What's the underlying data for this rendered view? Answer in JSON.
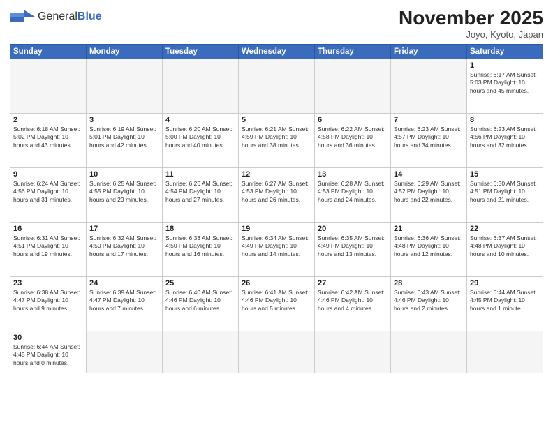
{
  "header": {
    "logo_general": "General",
    "logo_blue": "Blue",
    "month_title": "November 2025",
    "location": "Joyo, Kyoto, Japan"
  },
  "weekdays": [
    "Sunday",
    "Monday",
    "Tuesday",
    "Wednesday",
    "Thursday",
    "Friday",
    "Saturday"
  ],
  "weeks": [
    [
      {
        "day": "",
        "info": "",
        "empty": true
      },
      {
        "day": "",
        "info": "",
        "empty": true
      },
      {
        "day": "",
        "info": "",
        "empty": true
      },
      {
        "day": "",
        "info": "",
        "empty": true
      },
      {
        "day": "",
        "info": "",
        "empty": true
      },
      {
        "day": "",
        "info": "",
        "empty": true
      },
      {
        "day": "1",
        "info": "Sunrise: 6:17 AM\nSunset: 5:03 PM\nDaylight: 10 hours\nand 45 minutes."
      }
    ],
    [
      {
        "day": "2",
        "info": "Sunrise: 6:18 AM\nSunset: 5:02 PM\nDaylight: 10 hours\nand 43 minutes."
      },
      {
        "day": "3",
        "info": "Sunrise: 6:19 AM\nSunset: 5:01 PM\nDaylight: 10 hours\nand 42 minutes."
      },
      {
        "day": "4",
        "info": "Sunrise: 6:20 AM\nSunset: 5:00 PM\nDaylight: 10 hours\nand 40 minutes."
      },
      {
        "day": "5",
        "info": "Sunrise: 6:21 AM\nSunset: 4:59 PM\nDaylight: 10 hours\nand 38 minutes."
      },
      {
        "day": "6",
        "info": "Sunrise: 6:22 AM\nSunset: 4:58 PM\nDaylight: 10 hours\nand 36 minutes."
      },
      {
        "day": "7",
        "info": "Sunrise: 6:23 AM\nSunset: 4:57 PM\nDaylight: 10 hours\nand 34 minutes."
      },
      {
        "day": "8",
        "info": "Sunrise: 6:23 AM\nSunset: 4:56 PM\nDaylight: 10 hours\nand 32 minutes."
      }
    ],
    [
      {
        "day": "9",
        "info": "Sunrise: 6:24 AM\nSunset: 4:56 PM\nDaylight: 10 hours\nand 31 minutes."
      },
      {
        "day": "10",
        "info": "Sunrise: 6:25 AM\nSunset: 4:55 PM\nDaylight: 10 hours\nand 29 minutes."
      },
      {
        "day": "11",
        "info": "Sunrise: 6:26 AM\nSunset: 4:54 PM\nDaylight: 10 hours\nand 27 minutes."
      },
      {
        "day": "12",
        "info": "Sunrise: 6:27 AM\nSunset: 4:53 PM\nDaylight: 10 hours\nand 26 minutes."
      },
      {
        "day": "13",
        "info": "Sunrise: 6:28 AM\nSunset: 4:53 PM\nDaylight: 10 hours\nand 24 minutes."
      },
      {
        "day": "14",
        "info": "Sunrise: 6:29 AM\nSunset: 4:52 PM\nDaylight: 10 hours\nand 22 minutes."
      },
      {
        "day": "15",
        "info": "Sunrise: 6:30 AM\nSunset: 4:51 PM\nDaylight: 10 hours\nand 21 minutes."
      }
    ],
    [
      {
        "day": "16",
        "info": "Sunrise: 6:31 AM\nSunset: 4:51 PM\nDaylight: 10 hours\nand 19 minutes."
      },
      {
        "day": "17",
        "info": "Sunrise: 6:32 AM\nSunset: 4:50 PM\nDaylight: 10 hours\nand 17 minutes."
      },
      {
        "day": "18",
        "info": "Sunrise: 6:33 AM\nSunset: 4:50 PM\nDaylight: 10 hours\nand 16 minutes."
      },
      {
        "day": "19",
        "info": "Sunrise: 6:34 AM\nSunset: 4:49 PM\nDaylight: 10 hours\nand 14 minutes."
      },
      {
        "day": "20",
        "info": "Sunrise: 6:35 AM\nSunset: 4:49 PM\nDaylight: 10 hours\nand 13 minutes."
      },
      {
        "day": "21",
        "info": "Sunrise: 6:36 AM\nSunset: 4:48 PM\nDaylight: 10 hours\nand 12 minutes."
      },
      {
        "day": "22",
        "info": "Sunrise: 6:37 AM\nSunset: 4:48 PM\nDaylight: 10 hours\nand 10 minutes."
      }
    ],
    [
      {
        "day": "23",
        "info": "Sunrise: 6:38 AM\nSunset: 4:47 PM\nDaylight: 10 hours\nand 9 minutes."
      },
      {
        "day": "24",
        "info": "Sunrise: 6:39 AM\nSunset: 4:47 PM\nDaylight: 10 hours\nand 7 minutes."
      },
      {
        "day": "25",
        "info": "Sunrise: 6:40 AM\nSunset: 4:46 PM\nDaylight: 10 hours\nand 6 minutes."
      },
      {
        "day": "26",
        "info": "Sunrise: 6:41 AM\nSunset: 4:46 PM\nDaylight: 10 hours\nand 5 minutes."
      },
      {
        "day": "27",
        "info": "Sunrise: 6:42 AM\nSunset: 4:46 PM\nDaylight: 10 hours\nand 4 minutes."
      },
      {
        "day": "28",
        "info": "Sunrise: 6:43 AM\nSunset: 4:46 PM\nDaylight: 10 hours\nand 2 minutes."
      },
      {
        "day": "29",
        "info": "Sunrise: 6:44 AM\nSunset: 4:45 PM\nDaylight: 10 hours\nand 1 minute."
      }
    ],
    [
      {
        "day": "30",
        "info": "Sunrise: 6:44 AM\nSunset: 4:45 PM\nDaylight: 10 hours\nand 0 minutes.",
        "last": true
      },
      {
        "day": "",
        "info": "",
        "empty": true,
        "last": true
      },
      {
        "day": "",
        "info": "",
        "empty": true,
        "last": true
      },
      {
        "day": "",
        "info": "",
        "empty": true,
        "last": true
      },
      {
        "day": "",
        "info": "",
        "empty": true,
        "last": true
      },
      {
        "day": "",
        "info": "",
        "empty": true,
        "last": true
      },
      {
        "day": "",
        "info": "",
        "empty": true,
        "last": true
      }
    ]
  ]
}
